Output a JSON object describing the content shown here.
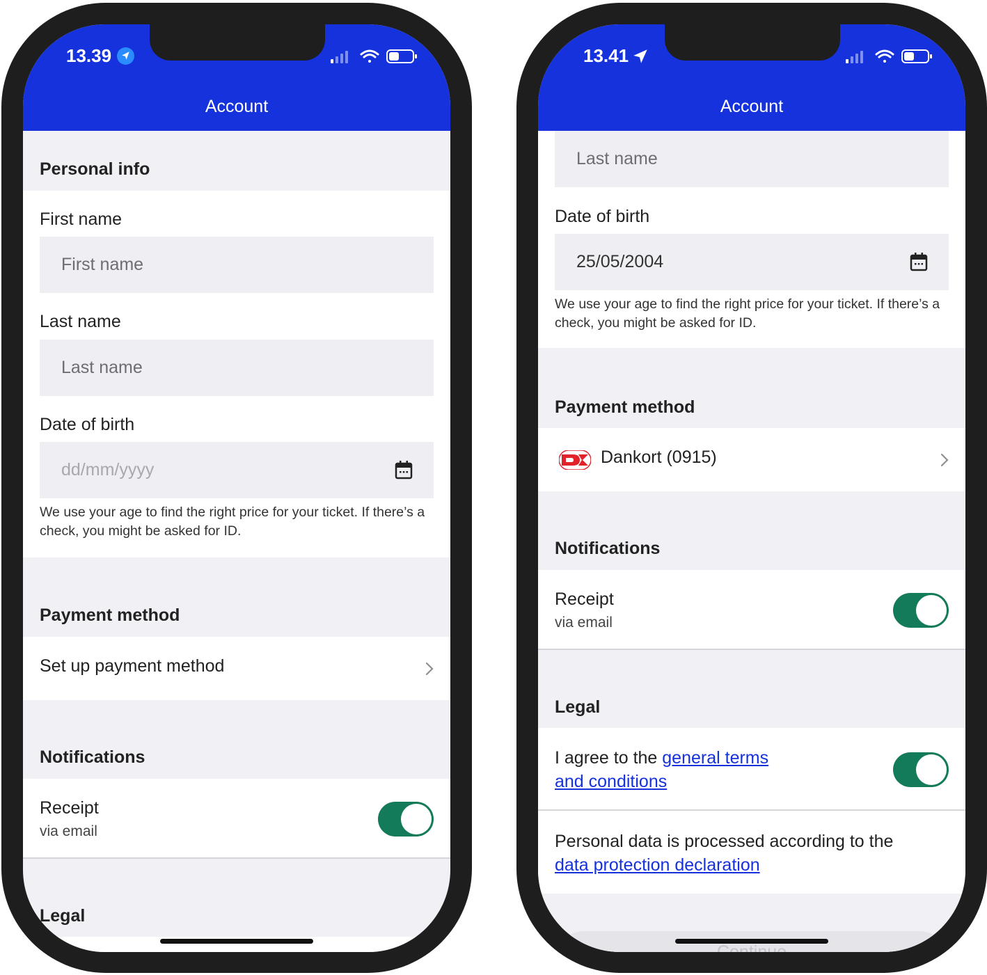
{
  "colors": {
    "brand_blue": "#1532dc",
    "toggle_green": "#137a5a",
    "link_blue": "#1532dc",
    "section_bg": "#f0f0f5"
  },
  "left": {
    "status": {
      "time": "13.39"
    },
    "header": {
      "title": "Account"
    },
    "personal_info": {
      "heading": "Personal info",
      "first_name": {
        "label": "First name",
        "placeholder": "First name"
      },
      "last_name": {
        "label": "Last name",
        "placeholder": "Last name"
      },
      "dob": {
        "label": "Date of birth",
        "placeholder": "dd/mm/yyyy",
        "icon": "calendar-icon"
      },
      "help": "We use your age to find the right price for your ticket. If there’s a check, you might be asked for ID."
    },
    "payment": {
      "heading": "Payment method",
      "setup": "Set up payment method"
    },
    "notifications": {
      "heading": "Notifications",
      "receipt": "Receipt",
      "receipt_sub": "via email",
      "receipt_on": true
    },
    "legal": {
      "heading": "Legal"
    }
  },
  "right": {
    "status": {
      "time": "13.41"
    },
    "header": {
      "title": "Account"
    },
    "personal_info": {
      "last_name": {
        "placeholder": "Last name"
      },
      "dob": {
        "label": "Date of birth",
        "value": "25/05/2004",
        "icon": "calendar-icon"
      },
      "help": "We use your age to find the right price for your ticket. If there’s a check, you might be asked for ID."
    },
    "payment": {
      "heading": "Payment method",
      "card": "Dankort (0915)",
      "card_logo": "dankort-logo"
    },
    "notifications": {
      "heading": "Notifications",
      "receipt": "Receipt",
      "receipt_sub": "via email",
      "receipt_on": true
    },
    "legal": {
      "heading": "Legal",
      "agree_prefix": "I agree to the ",
      "terms_link_1": "general terms",
      "terms_link_2": "and conditions",
      "agree_on": true,
      "data_text": "Personal data is processed according to the",
      "data_link": "data protection declaration"
    },
    "continue_label": "Continue"
  }
}
